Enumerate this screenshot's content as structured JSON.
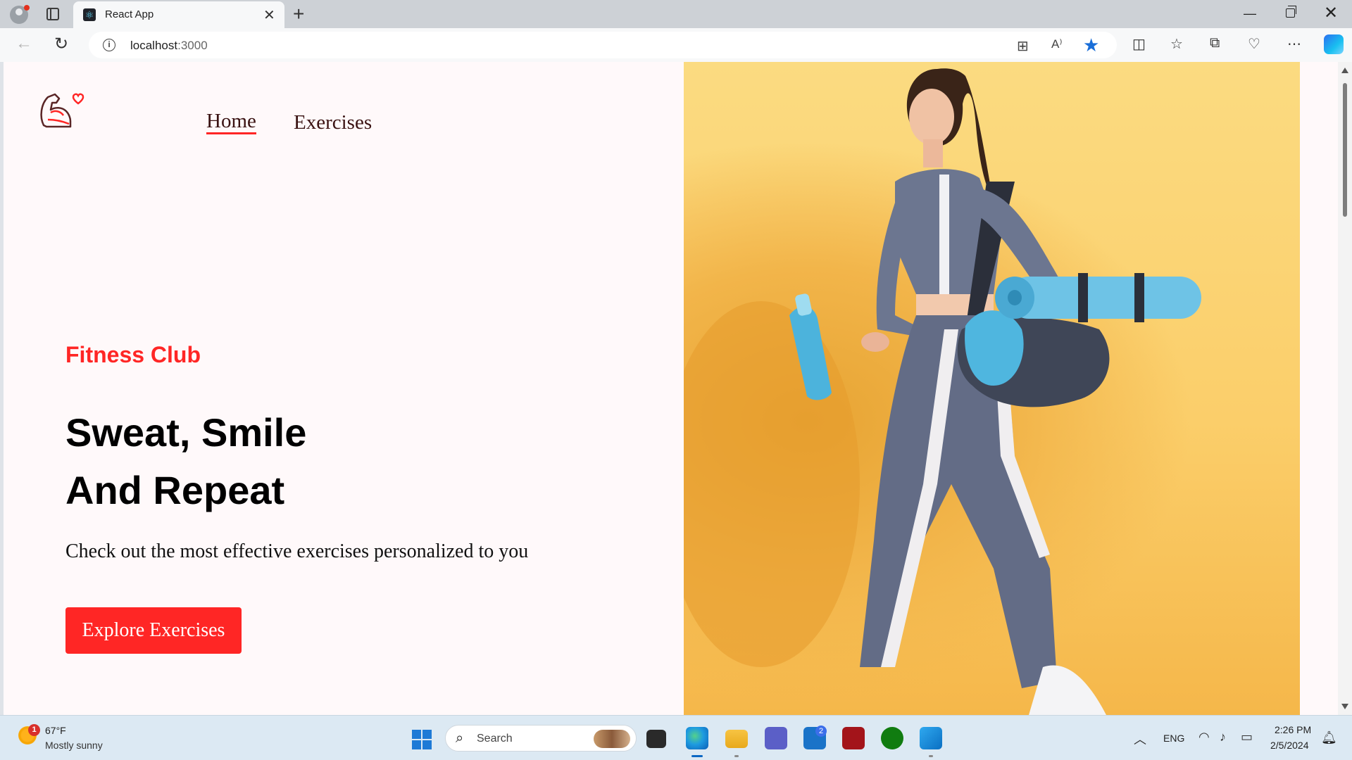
{
  "browser": {
    "tab_title": "React App",
    "url_host": "localhost",
    "url_port": ":3000"
  },
  "page": {
    "nav": {
      "home": "Home",
      "exercises": "Exercises"
    },
    "hero": {
      "tagline": "Fitness Club",
      "headline_line1": "Sweat, Smile",
      "headline_line2": "And Repeat",
      "subtitle": "Check out the most effective exercises personalized to you",
      "cta": "Explore Exercises"
    },
    "colors": {
      "accent": "#ff2625",
      "hero_bg": "#fbd670"
    }
  },
  "taskbar": {
    "weather": {
      "temp": "67°F",
      "condition": "Mostly sunny",
      "badge": "1"
    },
    "search_placeholder": "Search",
    "mail_badge": "2",
    "language": "ENG",
    "time": "2:26 PM",
    "date": "2/5/2024"
  }
}
